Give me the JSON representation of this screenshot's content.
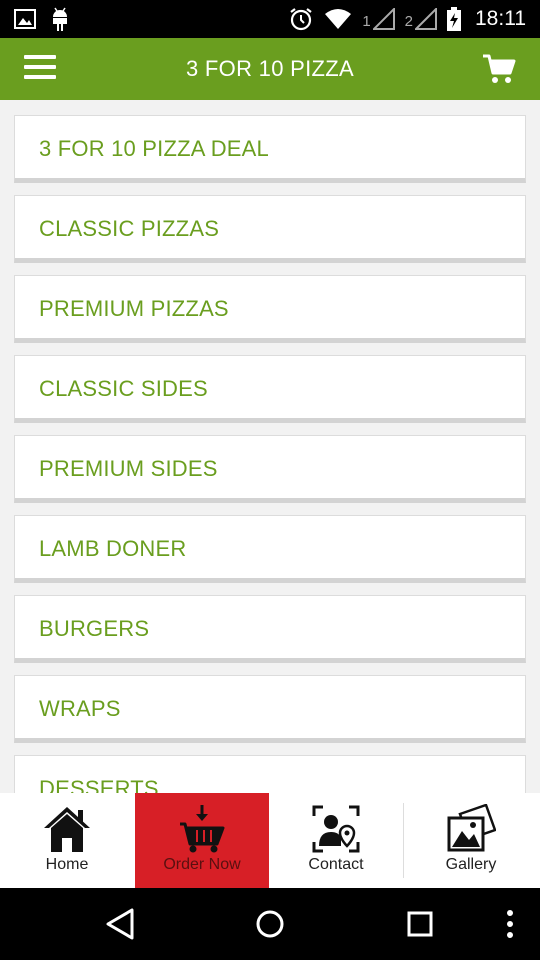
{
  "status_bar": {
    "time": "18:11",
    "sim1": "1",
    "sim2": "2",
    "icons": [
      "gallery-notification-icon",
      "android-icon",
      "alarm-icon",
      "wifi-icon",
      "signal-icon",
      "battery-charging-icon"
    ]
  },
  "header": {
    "title": "3 FOR 10 PIZZA",
    "menu_icon": "hamburger-menu-icon",
    "cart_icon": "shopping-cart-icon"
  },
  "menu": {
    "items": [
      {
        "label": "3 FOR 10 PIZZA DEAL"
      },
      {
        "label": "CLASSIC PIZZAS"
      },
      {
        "label": "PREMIUM PIZZAS"
      },
      {
        "label": "CLASSIC SIDES"
      },
      {
        "label": "PREMIUM SIDES"
      },
      {
        "label": "LAMB DONER"
      },
      {
        "label": "BURGERS"
      },
      {
        "label": "WRAPS"
      },
      {
        "label": "DESSERTS"
      }
    ]
  },
  "bottom_nav": {
    "items": [
      {
        "label": "Home",
        "icon": "home-icon"
      },
      {
        "label": "Order Now",
        "icon": "basket-icon",
        "active": true
      },
      {
        "label": "Contact",
        "icon": "contact-location-icon"
      },
      {
        "label": "Gallery",
        "icon": "gallery-icon"
      }
    ]
  },
  "colors": {
    "brand_green": "#6a9e1f",
    "active_red": "#d71f26",
    "content_bg": "#f2f2f2"
  },
  "system_nav": {
    "icons": [
      "back-icon",
      "home-circle-icon",
      "recents-icon",
      "more-vert-icon"
    ]
  }
}
